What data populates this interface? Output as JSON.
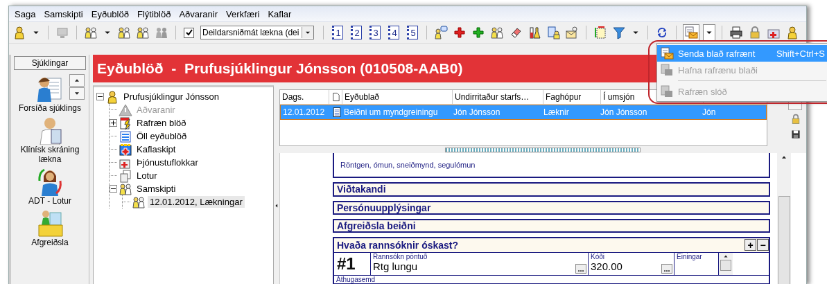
{
  "menu": [
    "Saga",
    "Samskipti",
    "Eyðublöð",
    "Flýtiblöð",
    "Aðvaranir",
    "Verkfæri",
    "Kaflar"
  ],
  "toolbar": {
    "filter_checkbox": {
      "checked": true
    },
    "view_select": {
      "value": "Deildarsniðmát lækna (dei"
    },
    "number_buttons": [
      "1",
      "2",
      "3",
      "4",
      "5"
    ]
  },
  "sidebar": {
    "header": "Sjúklingar",
    "items": [
      {
        "label": "Forsíða sjúklings"
      },
      {
        "label": "Klínísk skráning lækna"
      },
      {
        "label": "ADT - Lotur"
      },
      {
        "label": "Afgreiðsla"
      }
    ]
  },
  "title": "Eyðublöð  -  Prufusjúklingur Jónsson (010508-AAB0)",
  "tree": {
    "label": "Prufusjúklingur Jónsson",
    "expanded": true,
    "selected": false,
    "disabled": false,
    "children": [
      {
        "label": "Aðvaranir",
        "selected": false,
        "disabled": true
      },
      {
        "label": "Rafræn blöð",
        "expanded": false,
        "selected": false,
        "disabled": false
      },
      {
        "label": "Öll eyðublöð",
        "selected": false,
        "disabled": false
      },
      {
        "label": "Kaflaskipt",
        "selected": false,
        "disabled": false
      },
      {
        "label": "Þjónustuflokkar",
        "selected": false,
        "disabled": false
      },
      {
        "label": "Lotur",
        "selected": false,
        "disabled": false
      },
      {
        "label": "Samskipti",
        "expanded": true,
        "selected": false,
        "disabled": false,
        "children": [
          {
            "label": "12.01.2012, Lækningar",
            "selected": true,
            "disabled": false
          }
        ]
      }
    ]
  },
  "list": {
    "columns": [
      "Dags.",
      "Eyðublað",
      "Undirritaður starfs…",
      "Faghópur",
      "Í umsjón"
    ],
    "rows": [
      {
        "selected": true,
        "cells": [
          "12.01.2012",
          "Beiðni um myndgreiningu",
          "Jón Jónsson",
          "Læknir",
          "Jón Jónsson",
          "Jón"
        ]
      }
    ]
  },
  "form": {
    "intro_text": "Röntgen, ómun, sneiðmynd, segulómun",
    "sections": [
      {
        "title": "Viðtakandi"
      },
      {
        "title": "Persónuupplýsingar"
      },
      {
        "title": "Afgreiðsla beiðni"
      }
    ],
    "order_section": {
      "title": "Hvaða rannsóknir óskast?",
      "add_button": "+",
      "remove_button": "−",
      "item": {
        "number": "#1",
        "fields": [
          {
            "label": "Rannsókn pöntuð",
            "value": "Rtg lungu",
            "browse": "..."
          },
          {
            "label": "Kóði",
            "value": "320.00",
            "browse": "..."
          },
          {
            "label": "Einingar"
          }
        ]
      },
      "comment_label": "Athugasemd"
    }
  },
  "popup_menu": {
    "items": [
      {
        "kind": "item",
        "label": "Senda blað rafrænt",
        "shortcut": "Shift+Ctrl+S",
        "selected": true,
        "disabled": false
      },
      {
        "kind": "item",
        "label": "Hafna rafrænu blaði",
        "selected": false,
        "disabled": true
      },
      {
        "kind": "separator"
      },
      {
        "kind": "item",
        "label": "Rafræn slóð",
        "selected": false,
        "disabled": true
      }
    ]
  }
}
